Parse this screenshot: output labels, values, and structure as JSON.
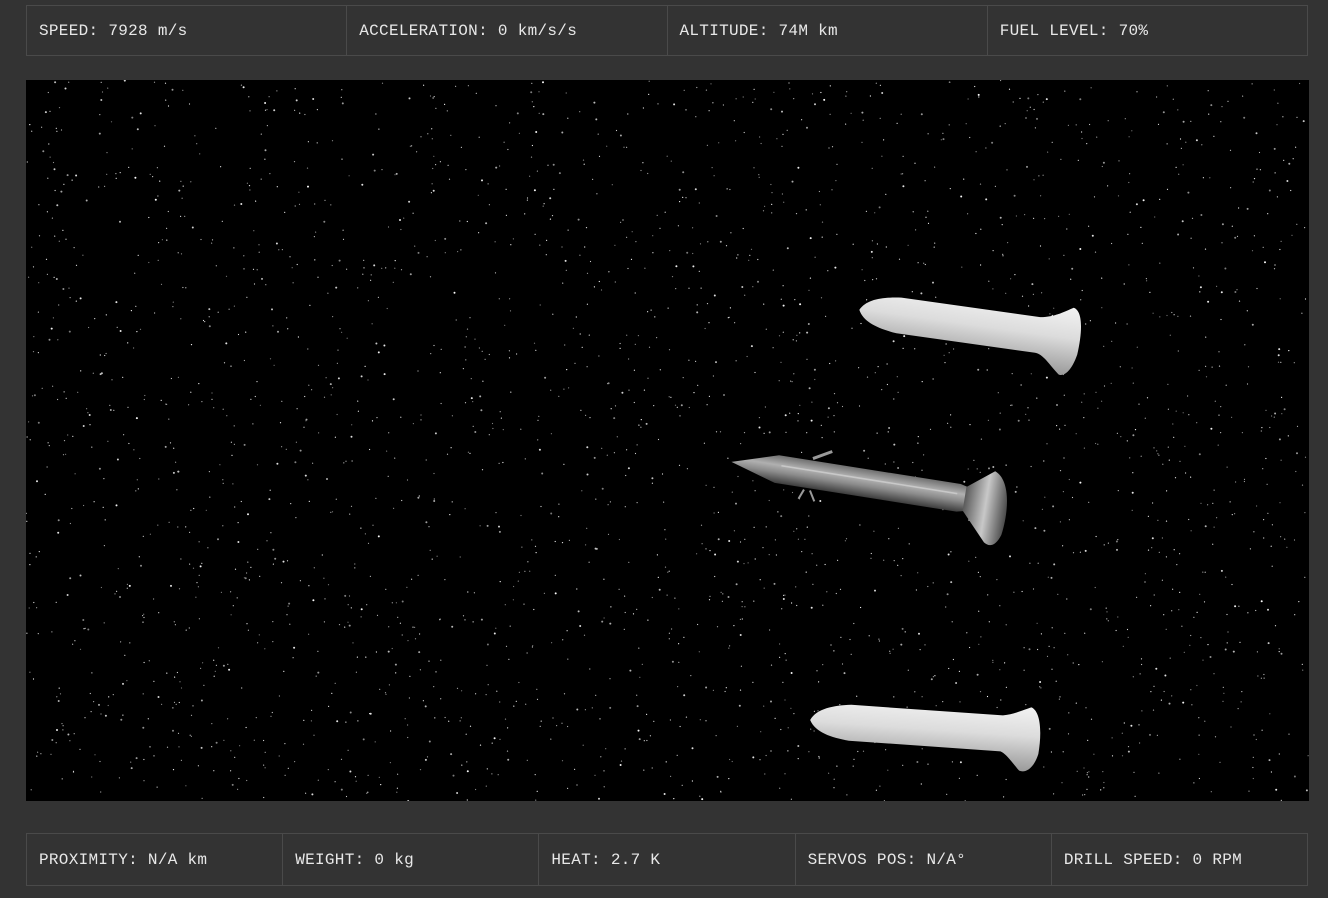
{
  "telemetry_top": [
    {
      "label": "SPEED:",
      "value": "7928 m/s"
    },
    {
      "label": "ACCELERATION:",
      "value": "0 km/s/s"
    },
    {
      "label": "ALTITUDE:",
      "value": "74M km"
    },
    {
      "label": "FUEL LEVEL:",
      "value": "70%"
    }
  ],
  "telemetry_bottom": [
    {
      "label": "PROXIMITY:",
      "value": "N/A km"
    },
    {
      "label": "WEIGHT:",
      "value": "0 kg"
    },
    {
      "label": "HEAT:",
      "value": "2.7 K"
    },
    {
      "label": "SERVOS POS:",
      "value": "N/A°"
    },
    {
      "label": "DRILL SPEED:",
      "value": "0 RPM"
    }
  ],
  "scene": {
    "objects": [
      "booster-top",
      "rocket-main",
      "booster-bottom"
    ],
    "colors": {
      "background": "#333333",
      "space": "#000000",
      "booster": "#d0d0d0",
      "rocket": "#8a8a8a",
      "text": "#e8e8e8"
    }
  }
}
